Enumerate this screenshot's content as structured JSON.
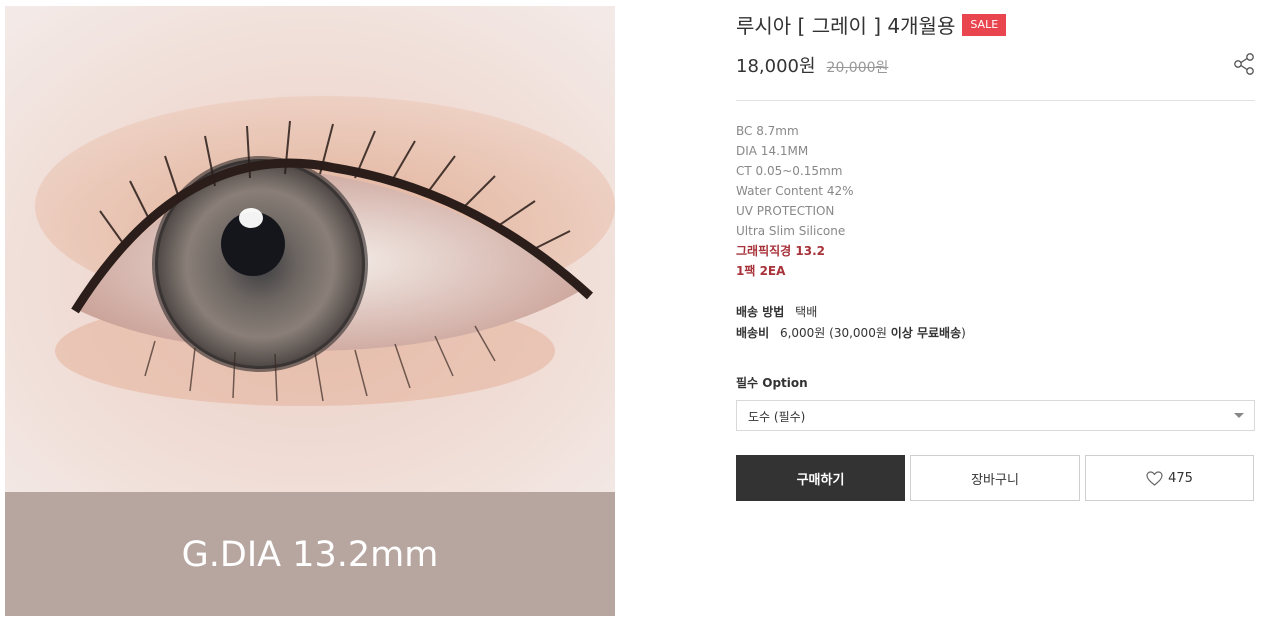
{
  "product": {
    "title": "루시아 [ 그레이 ] 4개월용",
    "sale_badge": "SALE",
    "price": "18,000원",
    "original_price": "20,000원"
  },
  "image": {
    "caption": "G.DIA 13.2mm"
  },
  "specs": {
    "lines": [
      "BC 8.7mm",
      "DIA 14.1MM",
      "CT 0.05~0.15mm",
      "Water Content 42%",
      "UV PROTECTION",
      "Ultra Slim Silicone"
    ],
    "highlights": [
      "그래픽직경 13.2",
      "1팩 2EA"
    ]
  },
  "shipping": {
    "method_label": "배송 방법",
    "method_value": "택배",
    "fee_label": "배송비",
    "fee_value": "6,000원 (30,000원",
    "fee_condition": "이상 무료배송",
    "fee_close": ")"
  },
  "option": {
    "label": "필수 Option",
    "selected": "도수 (필수)"
  },
  "buttons": {
    "buy": "구매하기",
    "cart": "장바구니",
    "like_count": "475"
  },
  "icons": {
    "share": "share-icon",
    "heart": "heart-icon",
    "dropdown": "chevron-down-icon"
  },
  "colors": {
    "sale": "#e8454f",
    "buy_button": "#333333",
    "highlight_text": "#a8333a",
    "caption_band": "#b7a6a0"
  }
}
